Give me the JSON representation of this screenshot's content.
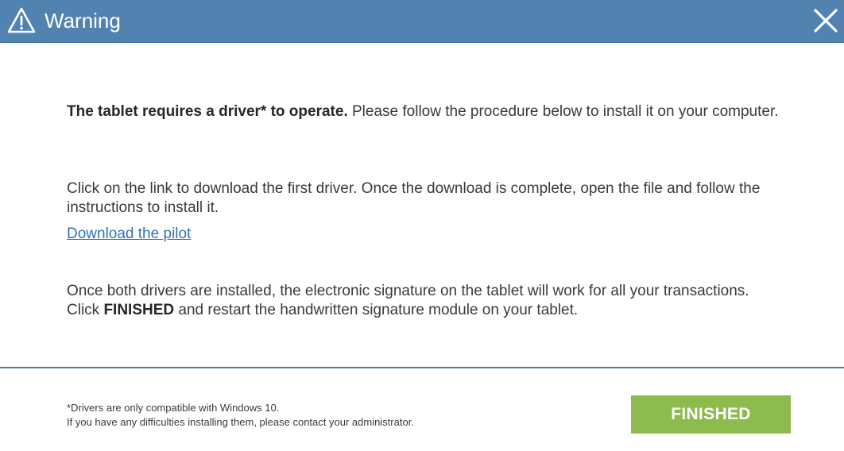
{
  "dialog": {
    "title": "Warning",
    "icon": "warning-triangle-icon",
    "close_icon": "close-icon"
  },
  "content": {
    "p1_bold": "The tablet requires a driver* to operate.",
    "p1_rest": " Please follow the procedure below to install it on your computer.",
    "p2": "Click on the link to download the first driver. Once the download is complete, open the file and follow the instructions to install it.",
    "download_link": "Download the pilot",
    "p3_line1": "Once both drivers are installed, the electronic signature on the tablet will work for all your transactions.",
    "p3_click": "Click ",
    "p3_finished": "FINISHED",
    "p3_rest": " and restart the handwritten signature module on your tablet."
  },
  "footer": {
    "note_line1": "*Drivers are only compatible with Windows 10.",
    "note_line2": "If you have any difficulties installing them, please contact your administrator.",
    "finish_label": "FINISHED"
  },
  "colors": {
    "titlebar": "#5283b0",
    "link": "#2e73b8",
    "finish_button": "#8dbb4e"
  }
}
